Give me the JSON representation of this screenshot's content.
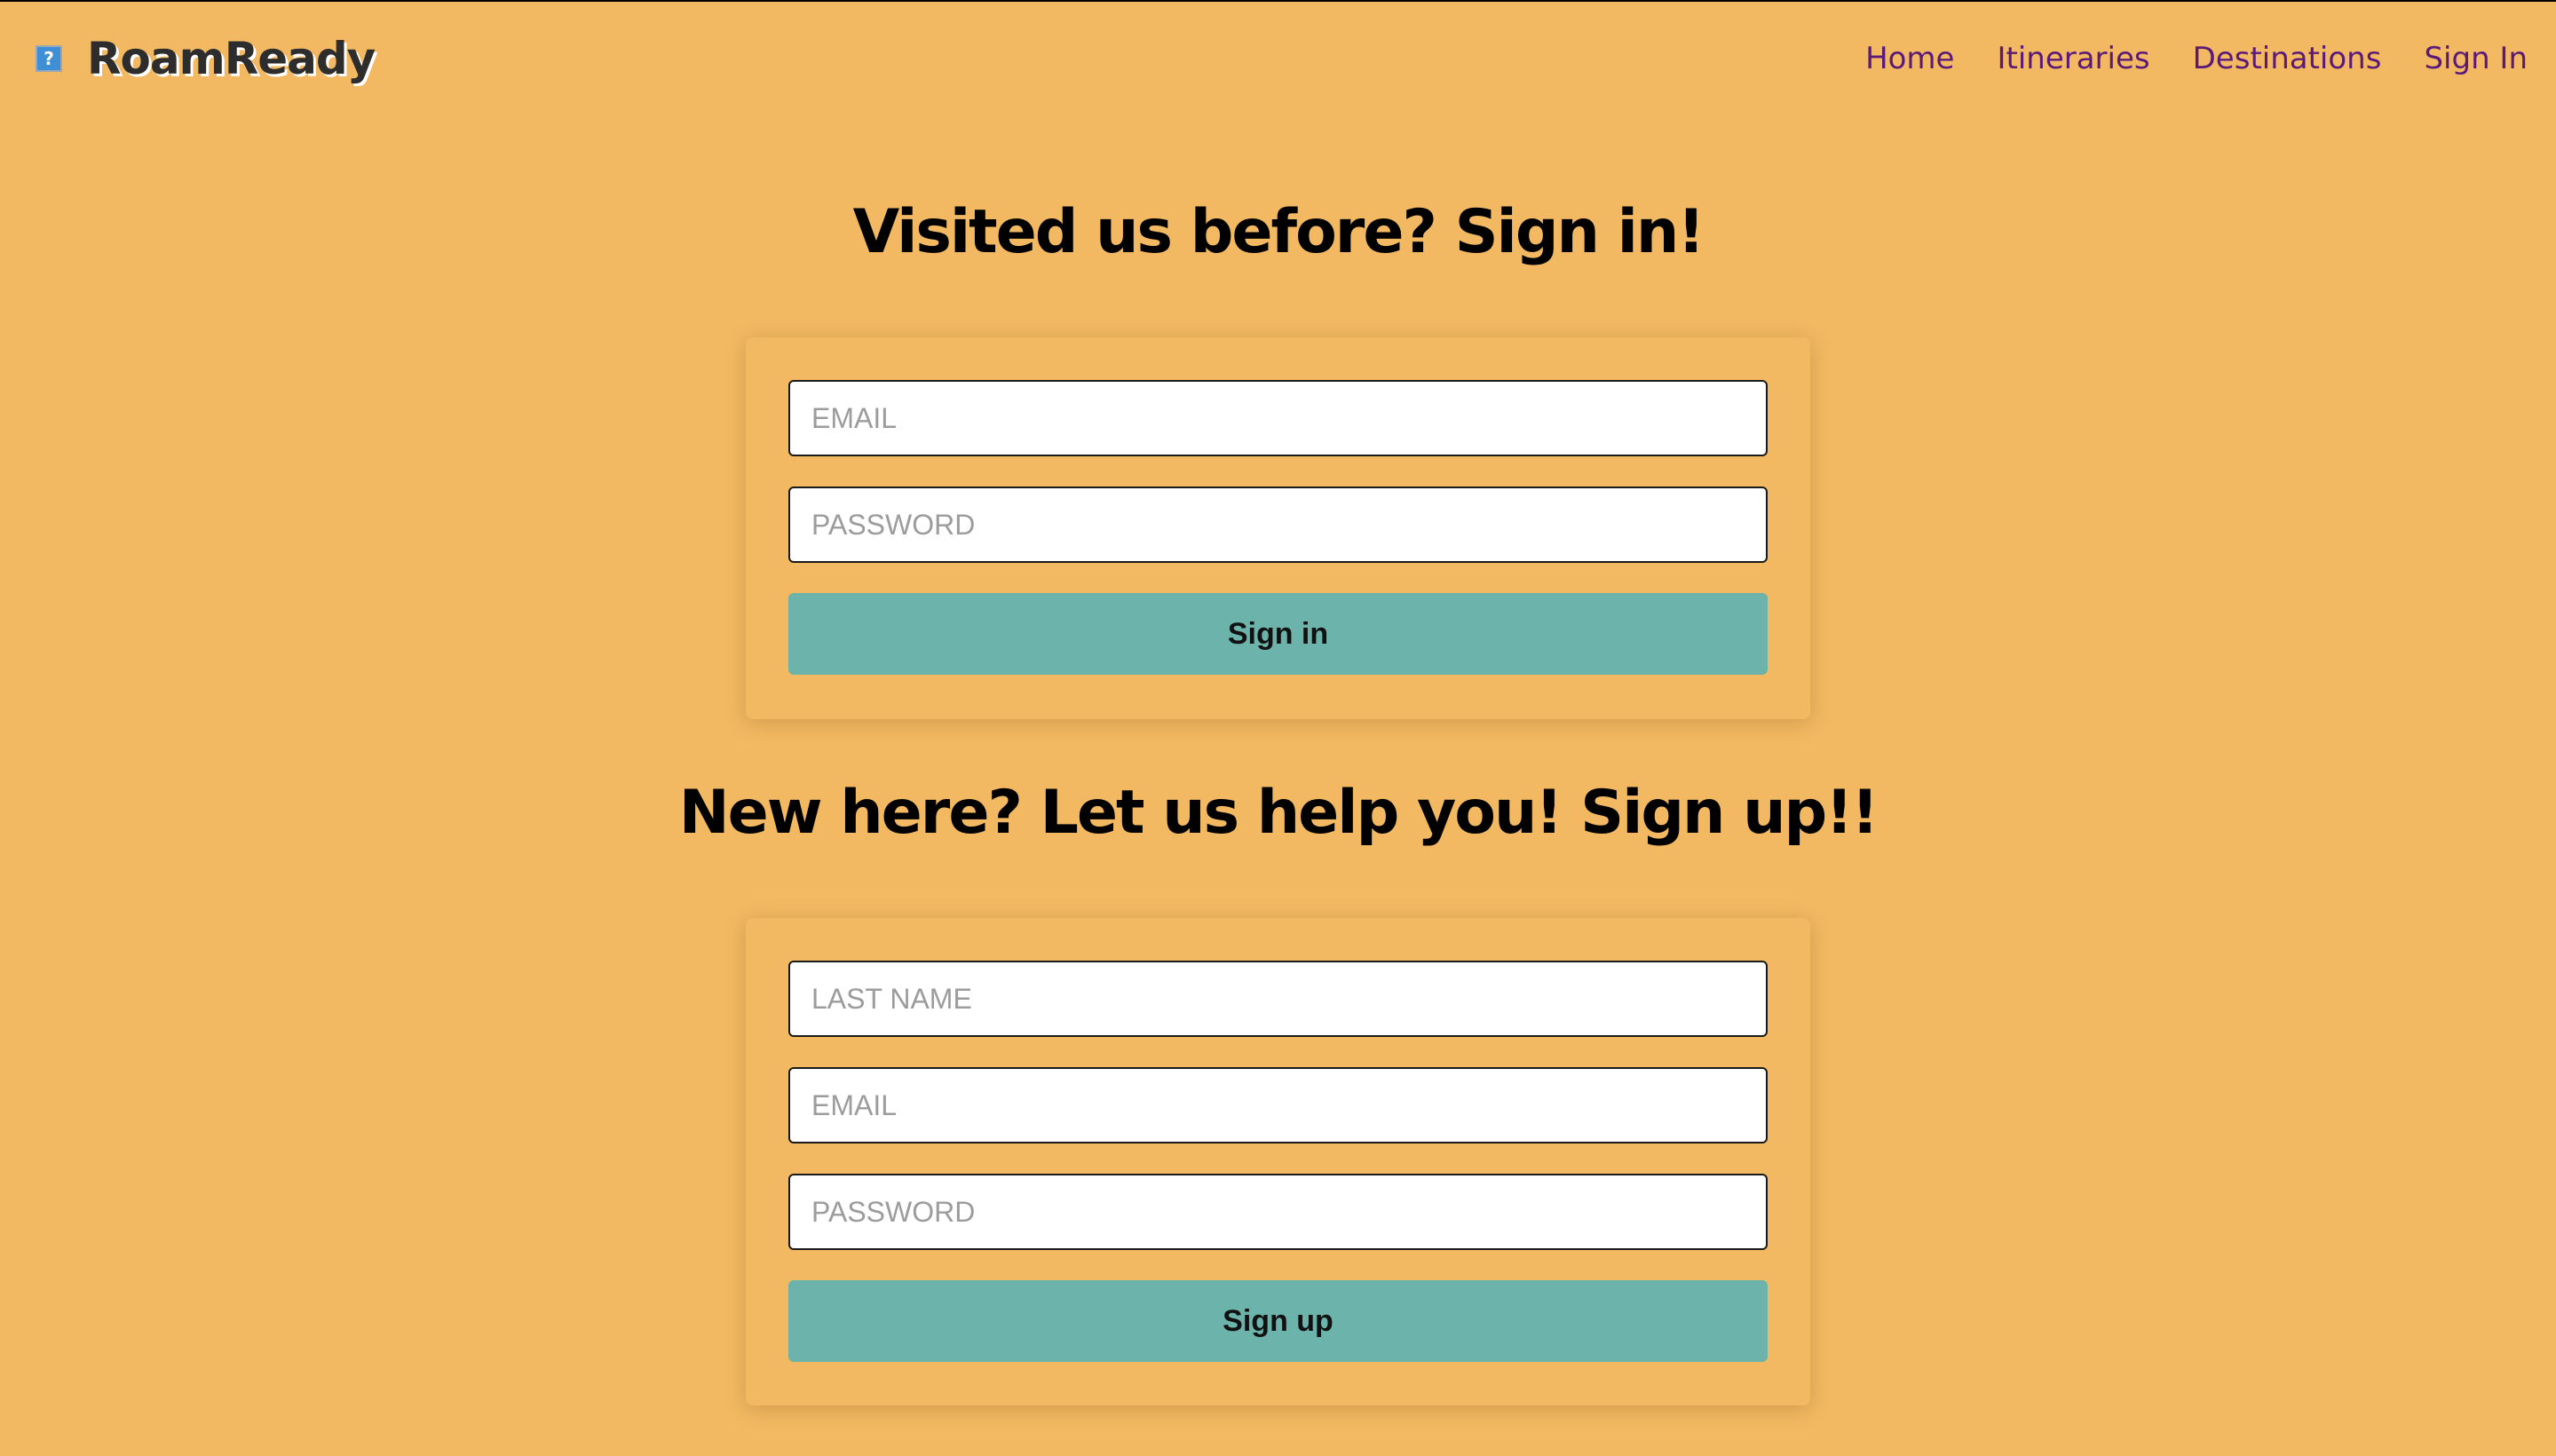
{
  "brand": {
    "name": "RoamReady",
    "logo_icon": "broken-image-icon",
    "logo_glyph": "?"
  },
  "nav": {
    "items": [
      {
        "label": "Home"
      },
      {
        "label": "Itineraries"
      },
      {
        "label": "Destinations"
      },
      {
        "label": "Sign In"
      }
    ]
  },
  "signin": {
    "heading": "Visited us before? Sign in!",
    "email_placeholder": "EMAIL",
    "email_value": "",
    "password_placeholder": "PASSWORD",
    "password_value": "",
    "button_label": "Sign in"
  },
  "signup": {
    "heading": "New here? Let us help you! Sign up!!",
    "last_name_placeholder": "LAST NAME",
    "last_name_value": "",
    "email_placeholder": "EMAIL",
    "email_value": "",
    "password_placeholder": "PASSWORD",
    "password_value": "",
    "button_label": "Sign up"
  },
  "colors": {
    "background": "#F3B962",
    "button": "#6CB3AB",
    "nav_link": "#5b1a78"
  }
}
